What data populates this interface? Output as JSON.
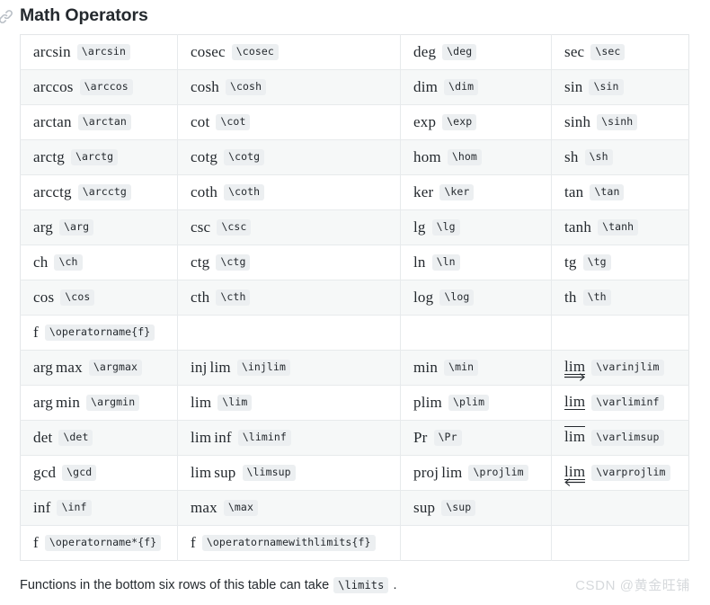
{
  "header": {
    "title": "Math Operators",
    "anchor_icon": "link-icon"
  },
  "table": {
    "rows": [
      [
        {
          "op": "arcsin",
          "tex": "\\arcsin"
        },
        {
          "op": "cosec",
          "tex": "\\cosec"
        },
        {
          "op": "deg",
          "tex": "\\deg"
        },
        {
          "op": "sec",
          "tex": "\\sec"
        }
      ],
      [
        {
          "op": "arccos",
          "tex": "\\arccos"
        },
        {
          "op": "cosh",
          "tex": "\\cosh"
        },
        {
          "op": "dim",
          "tex": "\\dim"
        },
        {
          "op": "sin",
          "tex": "\\sin"
        }
      ],
      [
        {
          "op": "arctan",
          "tex": "\\arctan"
        },
        {
          "op": "cot",
          "tex": "\\cot"
        },
        {
          "op": "exp",
          "tex": "\\exp"
        },
        {
          "op": "sinh",
          "tex": "\\sinh"
        }
      ],
      [
        {
          "op": "arctg",
          "tex": "\\arctg"
        },
        {
          "op": "cotg",
          "tex": "\\cotg"
        },
        {
          "op": "hom",
          "tex": "\\hom"
        },
        {
          "op": "sh",
          "tex": "\\sh"
        }
      ],
      [
        {
          "op": "arcctg",
          "tex": "\\arcctg"
        },
        {
          "op": "coth",
          "tex": "\\coth"
        },
        {
          "op": "ker",
          "tex": "\\ker"
        },
        {
          "op": "tan",
          "tex": "\\tan"
        }
      ],
      [
        {
          "op": "arg",
          "tex": "\\arg"
        },
        {
          "op": "csc",
          "tex": "\\csc"
        },
        {
          "op": "lg",
          "tex": "\\lg"
        },
        {
          "op": "tanh",
          "tex": "\\tanh"
        }
      ],
      [
        {
          "op": "ch",
          "tex": "\\ch"
        },
        {
          "op": "ctg",
          "tex": "\\ctg"
        },
        {
          "op": "ln",
          "tex": "\\ln"
        },
        {
          "op": "tg",
          "tex": "\\tg"
        }
      ],
      [
        {
          "op": "cos",
          "tex": "\\cos"
        },
        {
          "op": "cth",
          "tex": "\\cth"
        },
        {
          "op": "log",
          "tex": "\\log"
        },
        {
          "op": "th",
          "tex": "\\th"
        }
      ],
      [
        {
          "op": "f",
          "tex": "\\operatorname{f}"
        },
        {
          "op": "",
          "tex": ""
        },
        {
          "op": "",
          "tex": ""
        },
        {
          "op": "",
          "tex": ""
        }
      ],
      [
        {
          "op": "arg max",
          "tex": "\\argmax"
        },
        {
          "op": "inj lim",
          "tex": "\\injlim"
        },
        {
          "op": "min",
          "tex": "\\min"
        },
        {
          "op": "lim",
          "tex": "\\varinjlim",
          "deco": "arrow-right"
        }
      ],
      [
        {
          "op": "arg min",
          "tex": "\\argmin"
        },
        {
          "op": "lim",
          "tex": "\\lim"
        },
        {
          "op": "plim",
          "tex": "\\plim"
        },
        {
          "op": "lim",
          "tex": "\\varliminf",
          "deco": "bar-under"
        }
      ],
      [
        {
          "op": "det",
          "tex": "\\det"
        },
        {
          "op": "lim inf",
          "tex": "\\liminf"
        },
        {
          "op": "Pr",
          "tex": "\\Pr"
        },
        {
          "op": "lim",
          "tex": "\\varlimsup",
          "deco": "bar-over"
        }
      ],
      [
        {
          "op": "gcd",
          "tex": "\\gcd"
        },
        {
          "op": "lim sup",
          "tex": "\\limsup"
        },
        {
          "op": "proj lim",
          "tex": "\\projlim"
        },
        {
          "op": "lim",
          "tex": "\\varprojlim",
          "deco": "arrow-left"
        }
      ],
      [
        {
          "op": "inf",
          "tex": "\\inf"
        },
        {
          "op": "max",
          "tex": "\\max"
        },
        {
          "op": "sup",
          "tex": "\\sup"
        },
        {
          "op": "",
          "tex": ""
        }
      ],
      [
        {
          "op": "f",
          "tex": "\\operatorname*{f}"
        },
        {
          "op": "f",
          "tex": "\\operatornamewithlimits{f}"
        },
        {
          "op": "",
          "tex": ""
        },
        {
          "op": "",
          "tex": ""
        }
      ]
    ]
  },
  "note": {
    "text_before": "Functions in the bottom six rows of this table can take",
    "tex": "\\limits",
    "text_after": "."
  },
  "watermark": {
    "text": "CSDN @黄金旺铺"
  },
  "colors": {
    "text": "#24292e",
    "stripe": "#f6f8f8",
    "border": "#e7eaec",
    "code_bg": "#eceff1",
    "watermark": "#d6d9dc"
  }
}
